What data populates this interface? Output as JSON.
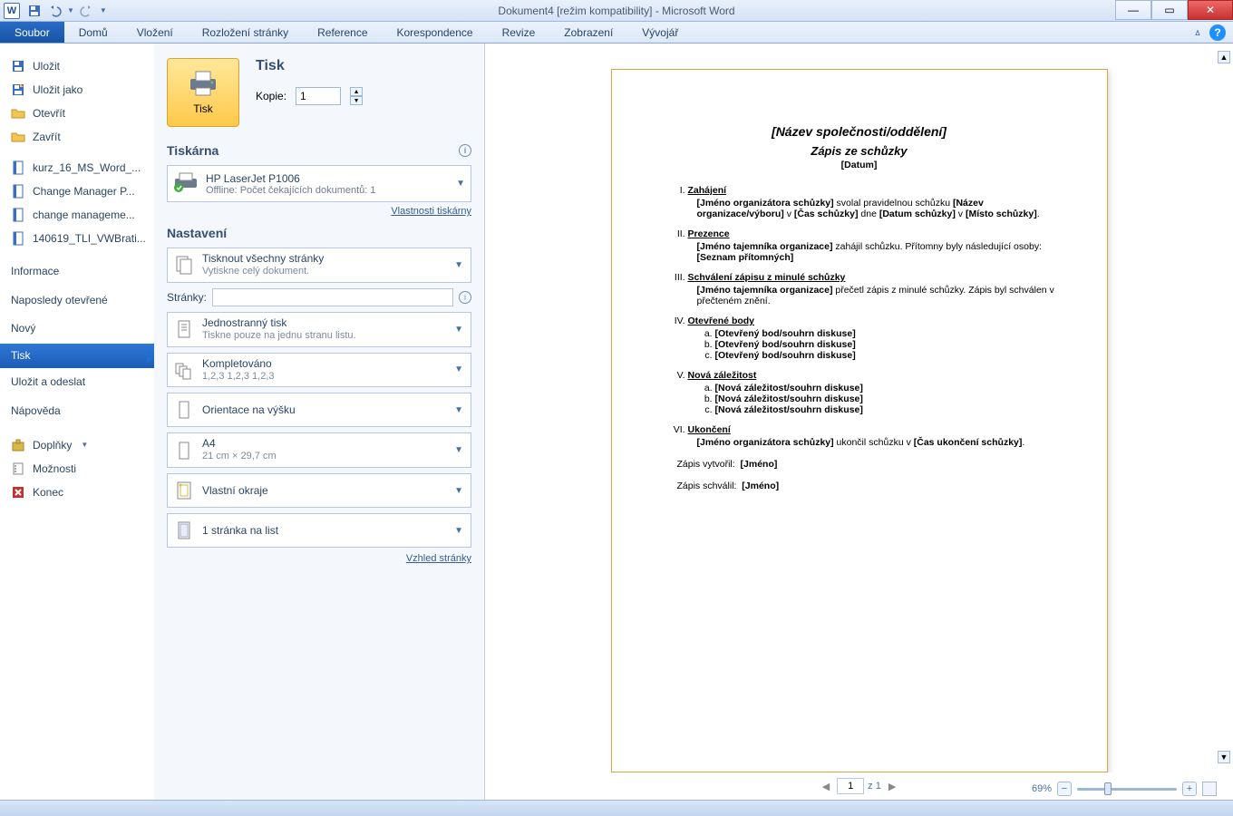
{
  "title": "Dokument4 [režim kompatibility] - Microsoft Word",
  "ribbon": {
    "file": "Soubor",
    "tabs": [
      "Domů",
      "Vložení",
      "Rozložení stránky",
      "Reference",
      "Korespondence",
      "Revize",
      "Zobrazení",
      "Vývojář"
    ]
  },
  "sidebar": {
    "save": "Uložit",
    "saveAs": "Uložit jako",
    "open": "Otevřít",
    "close": "Zavřít",
    "recent": [
      "kurz_16_MS_Word_...",
      "Change Manager P...",
      "change manageme...",
      "140619_TLI_VWBrati..."
    ],
    "info": "Informace",
    "recentLabel": "Naposledy otevřené",
    "new": "Nový",
    "print": "Tisk",
    "share": "Uložit a odeslat",
    "help": "Nápověda",
    "addins": "Doplňky",
    "options": "Možnosti",
    "exit": "Konec"
  },
  "printPanel": {
    "printBtn": "Tisk",
    "title": "Tisk",
    "copiesLabel": "Kopie:",
    "copies": "1",
    "printerH": "Tiskárna",
    "printerName": "HP LaserJet P1006",
    "printerStatus": "Offline: Počet čekajících dokumentů: 1",
    "printerProps": "Vlastnosti tiskárny",
    "settingsH": "Nastavení",
    "allPages": "Tisknout všechny stránky",
    "allPagesSub": "Vytiskne celý dokument.",
    "pagesLabel": "Stránky:",
    "pagesValue": "",
    "oneSided": "Jednostranný tisk",
    "oneSidedSub": "Tiskne pouze na jednu stranu listu.",
    "collated": "Kompletováno",
    "collatedSub": "1,2,3   1,2,3   1,2,3",
    "portrait": "Orientace na výšku",
    "a4": "A4",
    "a4Sub": "21 cm × 29,7 cm",
    "margins": "Vlastní okraje",
    "perSheet": "1 stránka na list",
    "pageSetup": "Vzhled stránky"
  },
  "preview": {
    "docTitle": "[Název společnosti/oddělení]",
    "docSub": "Zápis ze schůzky",
    "docDate": "[Datum]",
    "s1": "Zahájení",
    "s1b": "[Jméno organizátora schůzky] svolal pravidelnou schůzku [Název organizace/výboru] v [Čas schůzky] dne [Datum schůzky] v [Místo schůzky].",
    "s2": "Prezence",
    "s2b": "[Jméno tajemníka organizace] zahájil schůzku. Přítomny byly následující osoby: [Seznam přítomných]",
    "s3": "Schválení zápisu z minulé schůzky",
    "s3b": "[Jméno tajemníka organizace] přečetl zápis z minulé schůzky. Zápis byl schválen v přečteném znění.",
    "s4": "Otevřené body",
    "s4a": "[Otevřený bod/souhrn diskuse]",
    "s5": "Nová záležitost",
    "s5a": "[Nová záležitost/souhrn diskuse]",
    "s6": "Ukončení",
    "s6b": "[Jméno organizátora schůzky] ukončil schůzku v [Čas ukončení schůzky].",
    "sig1l": "Zápis vytvořil:",
    "sig1v": "[Jméno]",
    "sig2l": "Zápis schválil:",
    "sig2v": "[Jméno]"
  },
  "pager": {
    "cur": "1",
    "of": "z 1"
  },
  "zoom": "69%"
}
